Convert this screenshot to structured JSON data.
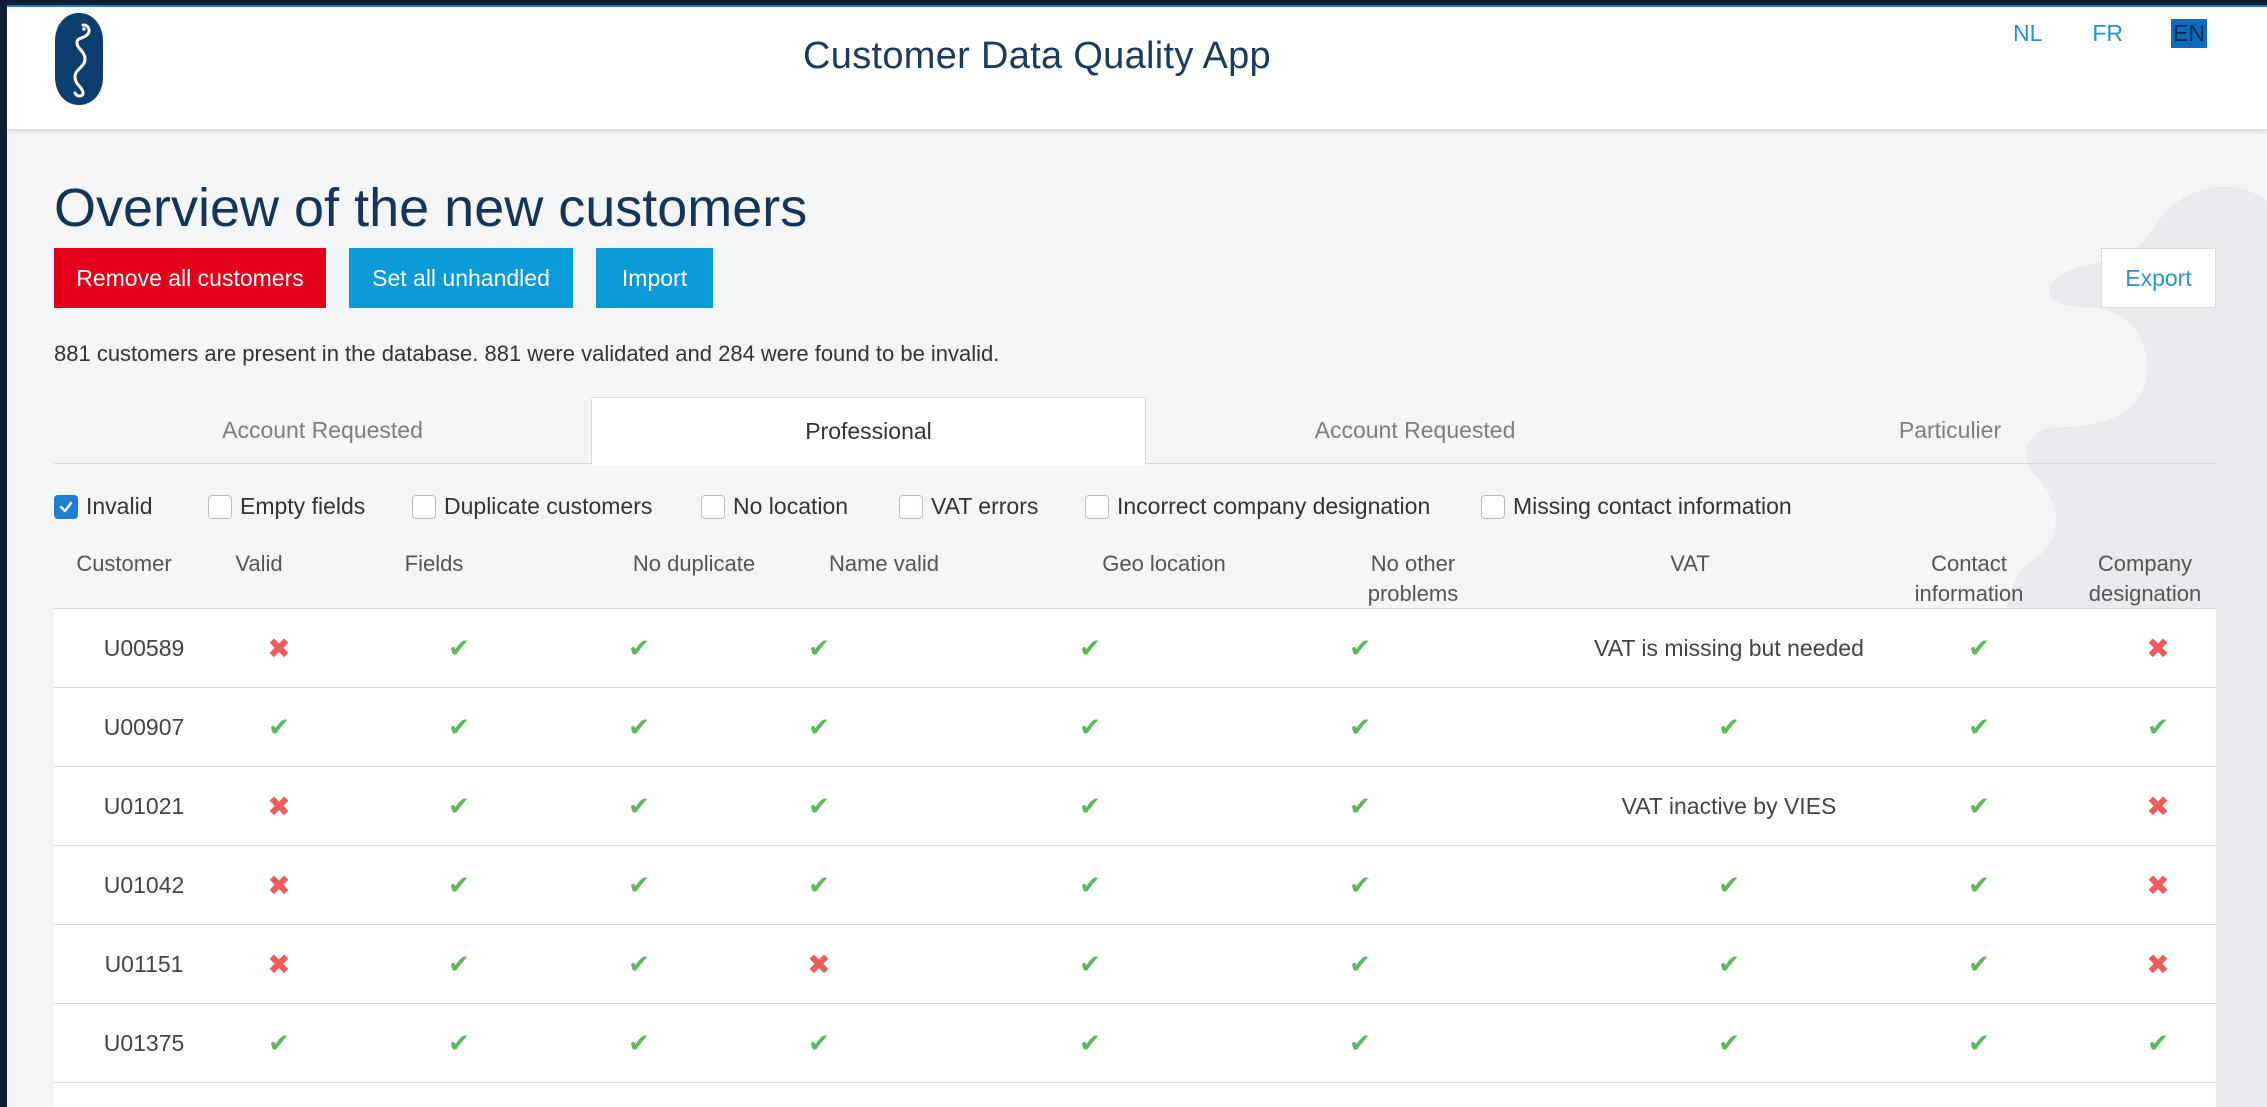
{
  "app": {
    "title": "Customer Data Quality App"
  },
  "languages": [
    {
      "code": "NL",
      "active": false
    },
    {
      "code": "FR",
      "active": false
    },
    {
      "code": "EN",
      "active": true
    }
  ],
  "page": {
    "title": "Overview of the new customers",
    "summary": "881 customers are present in the database. 881 were validated and 284 were found to be invalid."
  },
  "buttons": {
    "remove_all": "Remove all customers",
    "set_unhandled": "Set all unhandled",
    "import": "Import",
    "export": "Export"
  },
  "tabs": [
    {
      "label": "Account Requested",
      "active": false
    },
    {
      "label": "Professional",
      "active": true
    },
    {
      "label": "Account Requested",
      "active": false
    },
    {
      "label": "Particulier",
      "active": false
    }
  ],
  "filters": [
    {
      "label": "Invalid",
      "checked": true
    },
    {
      "label": "Empty fields",
      "checked": false
    },
    {
      "label": "Duplicate customers",
      "checked": false
    },
    {
      "label": "No location",
      "checked": false
    },
    {
      "label": "VAT errors",
      "checked": false
    },
    {
      "label": "Incorrect company designation",
      "checked": false
    },
    {
      "label": "Missing contact information",
      "checked": false
    }
  ],
  "table": {
    "columns": [
      "Customer",
      "Valid",
      "Fields",
      "No duplicate",
      "Name valid",
      "Geo location",
      "No other problems",
      "VAT",
      "Contact information",
      "Company designation"
    ],
    "rows": [
      {
        "customer": "U00589",
        "valid": false,
        "fields": true,
        "no_duplicate": true,
        "name_valid": true,
        "geo_location": true,
        "no_other_problems": true,
        "vat": "VAT is missing but needed",
        "contact": true,
        "company": false
      },
      {
        "customer": "U00907",
        "valid": true,
        "fields": true,
        "no_duplicate": true,
        "name_valid": true,
        "geo_location": true,
        "no_other_problems": true,
        "vat": true,
        "contact": true,
        "company": true
      },
      {
        "customer": "U01021",
        "valid": false,
        "fields": true,
        "no_duplicate": true,
        "name_valid": true,
        "geo_location": true,
        "no_other_problems": true,
        "vat": "VAT inactive by VIES",
        "contact": true,
        "company": false
      },
      {
        "customer": "U01042",
        "valid": false,
        "fields": true,
        "no_duplicate": true,
        "name_valid": true,
        "geo_location": true,
        "no_other_problems": true,
        "vat": true,
        "contact": true,
        "company": false
      },
      {
        "customer": "U01151",
        "valid": false,
        "fields": true,
        "no_duplicate": true,
        "name_valid": false,
        "geo_location": true,
        "no_other_problems": true,
        "vat": true,
        "contact": true,
        "company": false
      },
      {
        "customer": "U01375",
        "valid": true,
        "fields": true,
        "no_duplicate": true,
        "name_valid": true,
        "geo_location": true,
        "no_other_problems": true,
        "vat": true,
        "contact": true,
        "company": true
      },
      {
        "customer": "",
        "valid": true,
        "fields": true,
        "no_duplicate": true,
        "name_valid": true,
        "geo_location": true,
        "no_other_problems": true,
        "vat": true,
        "contact": true,
        "company": true
      }
    ]
  },
  "icons": {
    "check": "check-icon",
    "cross": "cross-icon",
    "logo": "seahorse-logo-icon",
    "watermark": "seahorse-watermark-icon"
  },
  "colors": {
    "primary": "#0b9ad8",
    "danger": "#e2001a",
    "ok": "#5cb85c",
    "bad": "#ef5b5b",
    "title": "#143557"
  }
}
